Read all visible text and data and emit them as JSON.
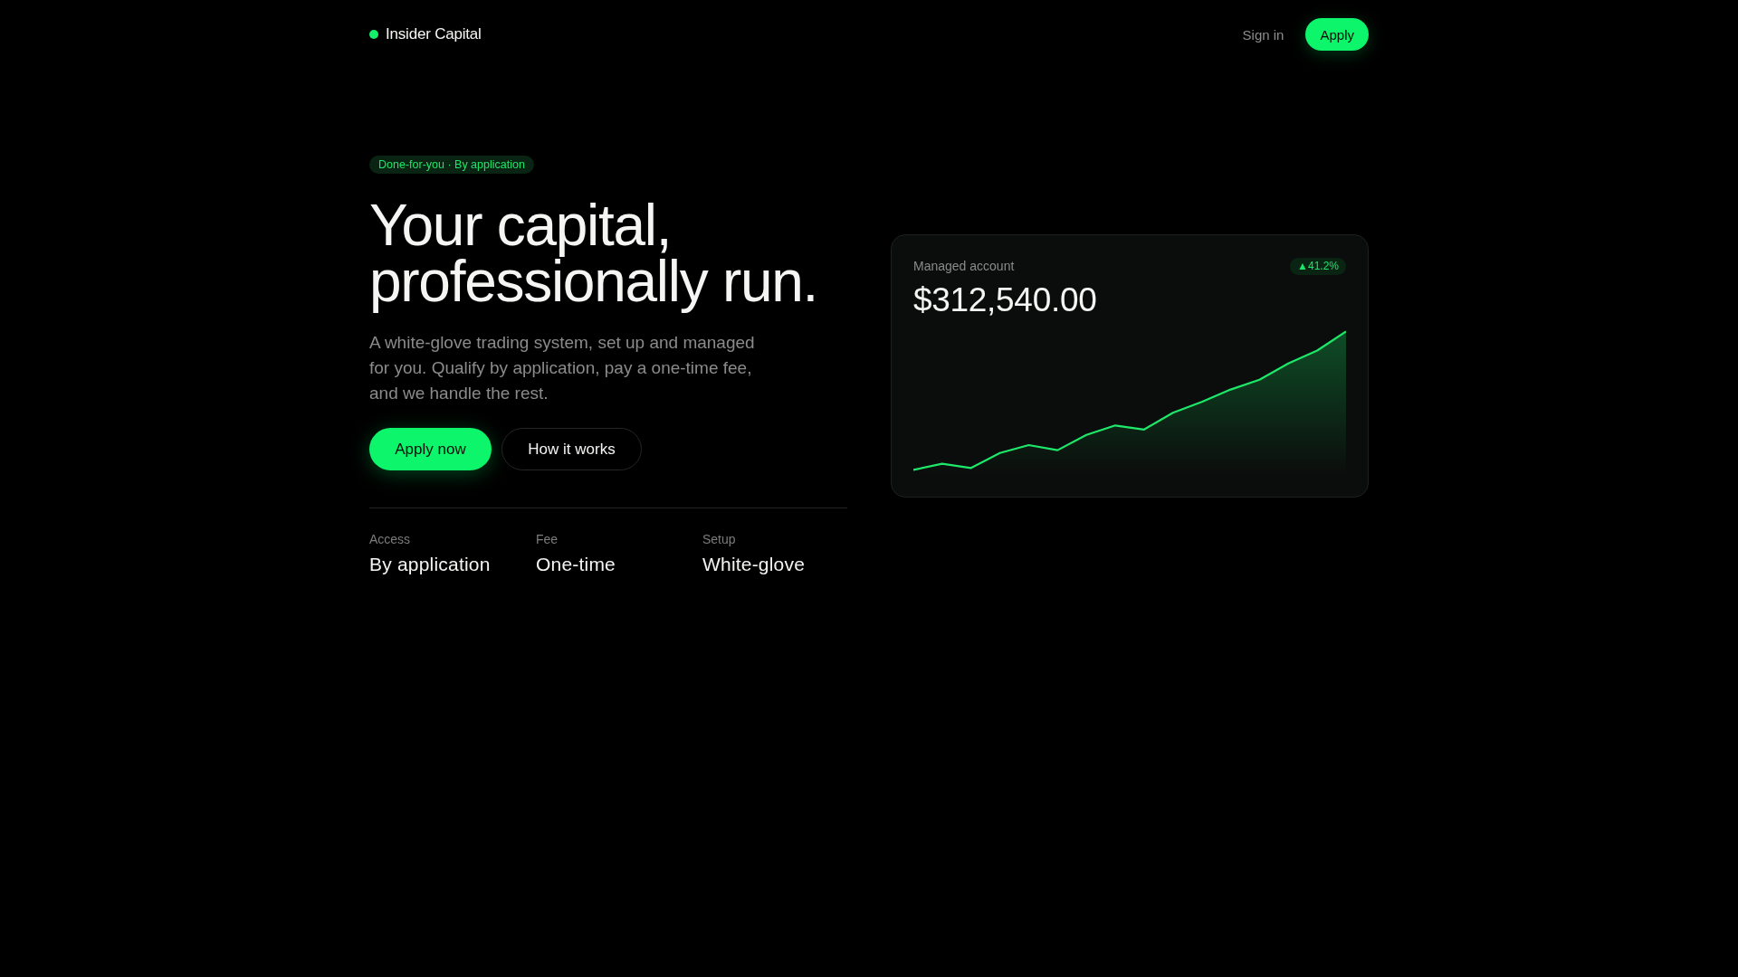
{
  "nav": {
    "brand": "Insider Capital",
    "links": [
      {
        "label": "Sign in"
      }
    ],
    "cta": "Apply"
  },
  "hero": {
    "tag": "Done-for-you · By application",
    "headline": "Your capital, professionally run.",
    "description": "A white-glove trading system, set up and managed for you. Qualify by application, pay a one-time fee, and we handle the rest.",
    "buttons": [
      {
        "label": "Apply now",
        "kind": "primary"
      },
      {
        "label": "How it works",
        "kind": "secondary"
      }
    ],
    "stats": [
      {
        "label": "Access",
        "value": "By application"
      },
      {
        "label": "Fee",
        "value": "One-time"
      },
      {
        "label": "Setup",
        "value": "White-glove"
      }
    ]
  },
  "account_card": {
    "label": "Managed account",
    "balance": "$312,540.00",
    "change": "▲41.2%"
  }
}
